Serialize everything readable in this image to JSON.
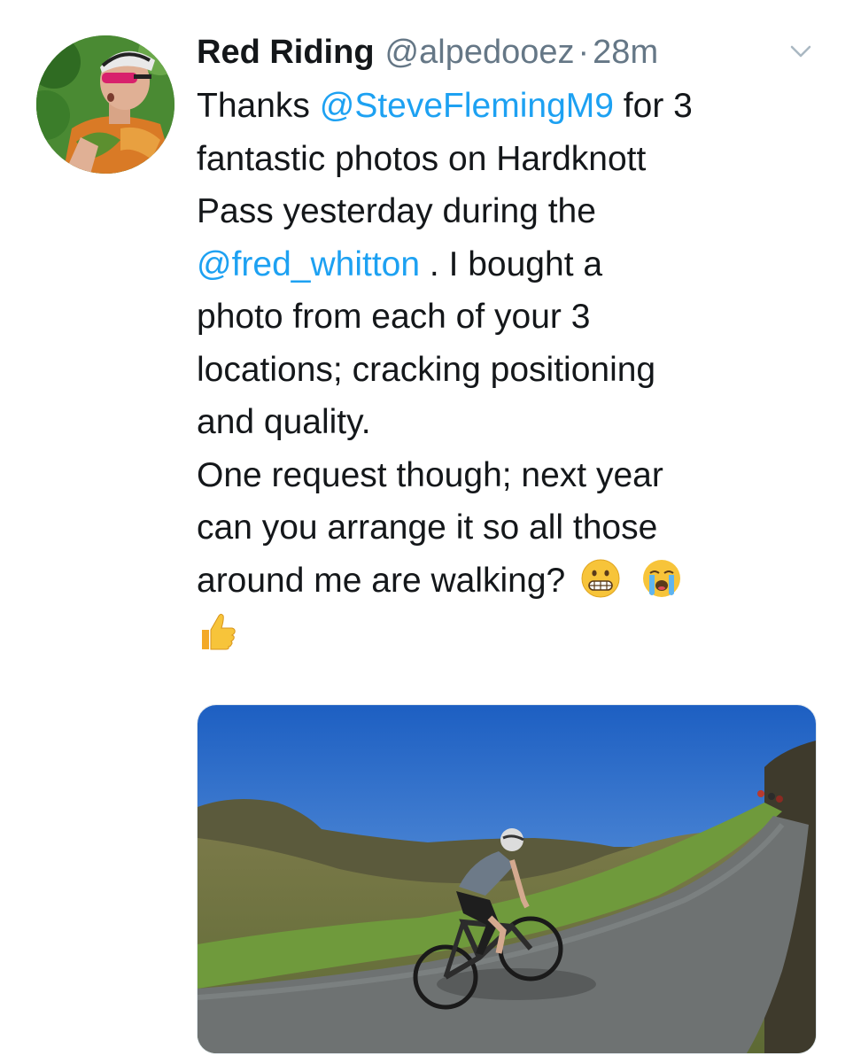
{
  "tweet": {
    "display_name": "Red Riding",
    "handle": "@alpedooez",
    "separator": "·",
    "time": "28m",
    "text": {
      "l1_a": "Thanks ",
      "l1_mention": "@SteveFlemingM9",
      "l1_b": " for 3",
      "l2": "fantastic photos on Hardknott",
      "l3": "Pass yesterday during the",
      "l4_mention": "@fred_whitton",
      "l4_b": " . I bought a",
      "l5": "photo from each of your 3",
      "l6": "locations; cracking positioning",
      "l7": "and quality.",
      "l8": "One request though; next year",
      "l9": "can you arrange it so all those",
      "l10": "around me are walking?"
    },
    "emojis": [
      "grimacing-face",
      "loudly-crying-face",
      "thumbs-up"
    ]
  },
  "colors": {
    "link": "#1da1f2",
    "secondary_text": "#657786",
    "primary_text": "#14171a"
  }
}
